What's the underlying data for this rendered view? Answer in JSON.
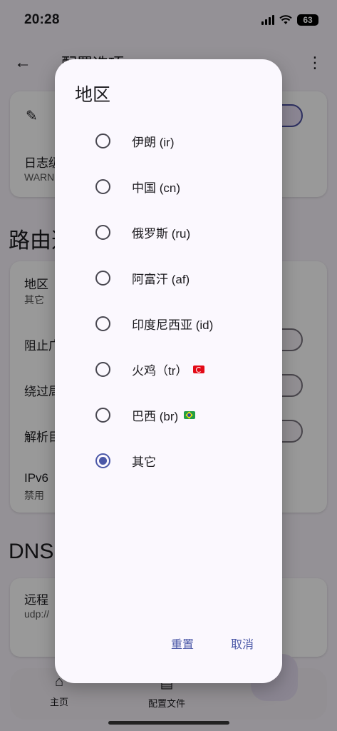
{
  "status_bar": {
    "time": "20:28",
    "battery": "63"
  },
  "app_bar": {
    "title": "配置选项",
    "back_icon": "arrow-left-icon",
    "more_icon": "more-vert-icon"
  },
  "background": {
    "log_row": {
      "title": "日志级别",
      "value": "WARN"
    },
    "routing_section_title": "路由选项",
    "routing_rows": [
      {
        "title": "地区",
        "value": "其它"
      },
      {
        "title": "阻止广告"
      },
      {
        "title": "绕过局域网"
      },
      {
        "title": "解析目标"
      },
      {
        "title": "IPv6",
        "value": "禁用"
      }
    ],
    "dns_section_title": "DNS",
    "dns_rows": [
      {
        "title": "远程",
        "value": "udp://"
      }
    ]
  },
  "bottom_nav": {
    "items": [
      {
        "label": "主页",
        "icon": "home-icon"
      },
      {
        "label": "配置文件",
        "icon": "profiles-icon"
      }
    ]
  },
  "dialog": {
    "title": "地区",
    "options": [
      {
        "label": "伊朗 (ir)",
        "selected": false
      },
      {
        "label": "中国 (cn)",
        "selected": false
      },
      {
        "label": "俄罗斯 (ru)",
        "selected": false
      },
      {
        "label": "阿富汗 (af)",
        "selected": false
      },
      {
        "label": "印度尼西亚 (id)",
        "selected": false
      },
      {
        "label": "火鸡（tr）",
        "selected": false,
        "flag": "turkey-flag-icon"
      },
      {
        "label": "巴西 (br)",
        "selected": false,
        "flag": "brazil-flag-icon"
      },
      {
        "label": "其它",
        "selected": true
      }
    ],
    "reset_label": "重置",
    "cancel_label": "取消"
  },
  "colors": {
    "accent": "#4a57a7",
    "dialog_bg": "#fbf8fe",
    "scrim": "rgba(0,0,0,0.40)"
  }
}
